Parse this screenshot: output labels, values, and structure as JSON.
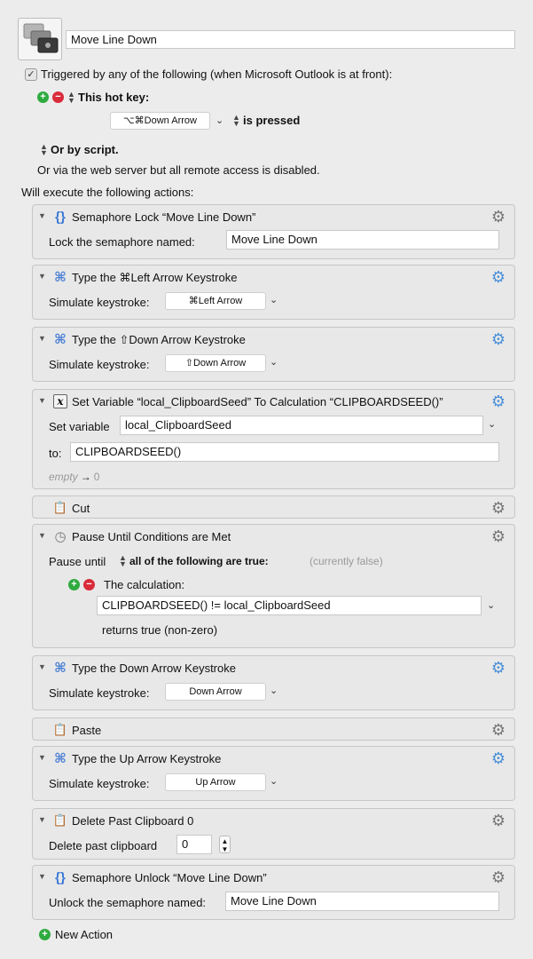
{
  "macro": {
    "name": "Move Line Down"
  },
  "trigger": {
    "checkbox_label": "Triggered by any of the following (when Microsoft Outlook is at front):",
    "hotkey_label": "This hot key:",
    "hotkey_value": "⌥⌘Down Arrow",
    "hotkey_state": "is pressed",
    "script_label": "Or by script.",
    "web_label": "Or via the web server but all remote access is disabled."
  },
  "actions_header": "Will execute the following actions:",
  "actions": [
    {
      "title": "Semaphore Lock “Move Line Down”",
      "label": "Lock the semaphore named:",
      "value": "Move Line Down"
    },
    {
      "title": "Type the ⌘Left Arrow Keystroke",
      "label": "Simulate keystroke:",
      "value": "⌘Left Arrow"
    },
    {
      "title": "Type the ⇧Down Arrow Keystroke",
      "label": "Simulate keystroke:",
      "value": "⇧Down Arrow"
    },
    {
      "title": "Set Variable “local_ClipboardSeed” To Calculation “CLIPBOARDSEED()”",
      "label": "Set variable",
      "value": "local_ClipboardSeed",
      "to_label": "to:",
      "to_value": "CLIPBOARDSEED()",
      "preview_empty": "empty",
      "preview_arrow": "→",
      "preview_value": "0"
    },
    {
      "title": "Cut"
    },
    {
      "title": "Pause Until Conditions are Met",
      "label": "Pause until",
      "condition": "all of the following are true:",
      "status": "(currently false)",
      "calc_label": "The calculation:",
      "calc_value": "CLIPBOARDSEED() != local_ClipboardSeed",
      "returns": "returns true (non-zero)"
    },
    {
      "title": "Type the Down Arrow Keystroke",
      "label": "Simulate keystroke:",
      "value": "Down Arrow"
    },
    {
      "title": "Paste"
    },
    {
      "title": "Type the Up Arrow Keystroke",
      "label": "Simulate keystroke:",
      "value": "Up Arrow"
    },
    {
      "title": "Delete Past Clipboard 0",
      "label": "Delete past clipboard",
      "value": "0"
    },
    {
      "title": "Semaphore Unlock “Move Line Down”",
      "label": "Unlock the semaphore named:",
      "value": "Move Line Down"
    }
  ],
  "new_action_label": "New Action",
  "icons": {
    "gear_active": "gear-icon-blue",
    "gear_inactive": "gear-icon-grey",
    "keystroke": "command-key-icon",
    "semaphore": "braces-icon",
    "variable": "x-variable-icon",
    "clipboard": "clipboard-icon",
    "pause": "clock-icon"
  },
  "colors": {
    "plus": "#2eaa3f",
    "minus": "#d92b3a",
    "gear_blue": "#4a90d9",
    "command_icon": "#4a7fd4",
    "semaphore_icon": "#3b78d6"
  }
}
